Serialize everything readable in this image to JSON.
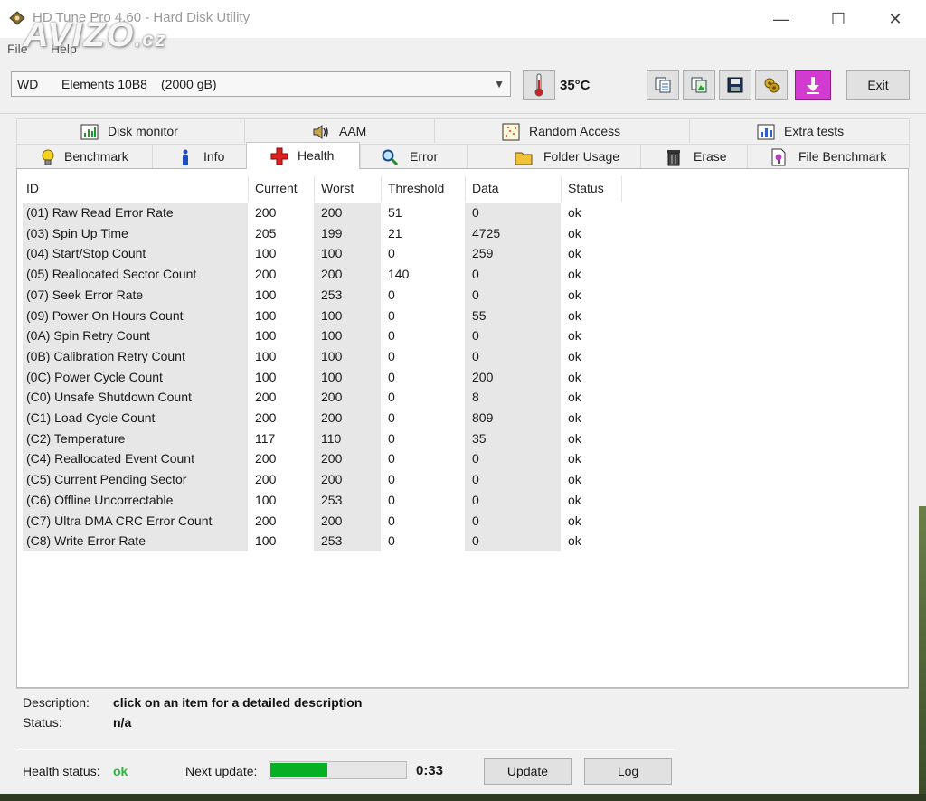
{
  "window": {
    "title": "HD Tune Pro 4.60 - Hard Disk Utility",
    "minimize": "—",
    "maximize": "☐",
    "close": "✕",
    "watermark": "AVIZO",
    "watermark_tld": ".cz"
  },
  "menu": {
    "file": "File",
    "help": "Help"
  },
  "toolbar": {
    "drive_vendor": "WD",
    "drive_model": "Elements 10B8",
    "drive_capacity": "(2000 gB)",
    "temperature": "35°C",
    "exit_label": "Exit",
    "icons": [
      "copy-info-icon",
      "copy-screenshot-icon",
      "save-icon",
      "options-icon",
      "download-icon"
    ]
  },
  "tabs": {
    "row1": [
      {
        "label": "Disk monitor",
        "icon": "disk-monitor-icon"
      },
      {
        "label": "AAM",
        "icon": "speaker-icon"
      },
      {
        "label": "Random Access",
        "icon": "random-access-icon"
      },
      {
        "label": "Extra tests",
        "icon": "extra-tests-icon"
      }
    ],
    "row2": [
      {
        "label": "Benchmark",
        "icon": "lightbulb-icon"
      },
      {
        "label": "Info",
        "icon": "info-icon"
      },
      {
        "label": "Health",
        "icon": "health-cross-icon",
        "active": true
      },
      {
        "label": "Error Scan",
        "icon": "magnifier-icon"
      },
      {
        "label": "Folder Usage",
        "icon": "folder-icon"
      },
      {
        "label": "Erase",
        "icon": "trash-icon"
      },
      {
        "label": "File Benchmark",
        "icon": "file-benchmark-icon"
      }
    ]
  },
  "smart_table": {
    "headers": [
      "ID",
      "Current",
      "Worst",
      "Threshold",
      "Data",
      "Status"
    ],
    "rows": [
      [
        "(01) Raw Read Error Rate",
        "200",
        "200",
        "51",
        "0",
        "ok"
      ],
      [
        "(03) Spin Up Time",
        "205",
        "199",
        "21",
        "4725",
        "ok"
      ],
      [
        "(04) Start/Stop Count",
        "100",
        "100",
        "0",
        "259",
        "ok"
      ],
      [
        "(05) Reallocated Sector Count",
        "200",
        "200",
        "140",
        "0",
        "ok"
      ],
      [
        "(07) Seek Error Rate",
        "100",
        "253",
        "0",
        "0",
        "ok"
      ],
      [
        "(09) Power On Hours Count",
        "100",
        "100",
        "0",
        "55",
        "ok"
      ],
      [
        "(0A) Spin Retry Count",
        "100",
        "100",
        "0",
        "0",
        "ok"
      ],
      [
        "(0B) Calibration Retry Count",
        "100",
        "100",
        "0",
        "0",
        "ok"
      ],
      [
        "(0C) Power Cycle Count",
        "100",
        "100",
        "0",
        "200",
        "ok"
      ],
      [
        "(C0) Unsafe Shutdown Count",
        "200",
        "200",
        "0",
        "8",
        "ok"
      ],
      [
        "(C1) Load Cycle Count",
        "200",
        "200",
        "0",
        "809",
        "ok"
      ],
      [
        "(C2) Temperature",
        "117",
        "110",
        "0",
        "35",
        "ok"
      ],
      [
        "(C4) Reallocated Event Count",
        "200",
        "200",
        "0",
        "0",
        "ok"
      ],
      [
        "(C5) Current Pending Sector",
        "200",
        "200",
        "0",
        "0",
        "ok"
      ],
      [
        "(C6) Offline Uncorrectable",
        "100",
        "253",
        "0",
        "0",
        "ok"
      ],
      [
        "(C7) Ultra DMA CRC Error Count",
        "200",
        "200",
        "0",
        "0",
        "ok"
      ],
      [
        "(C8) Write Error Rate",
        "100",
        "253",
        "0",
        "0",
        "ok"
      ]
    ]
  },
  "details": {
    "description_label": "Description:",
    "description_value": "click on an item for a detailed description",
    "status_label": "Status:",
    "status_value": "n/a"
  },
  "footer": {
    "health_label": "Health status:",
    "health_value": "ok",
    "health_color": "#2fb53c",
    "next_update_label": "Next update:",
    "next_update_progress": 0.42,
    "progress_color": "#06b025",
    "next_update_time": "0:33",
    "update_button": "Update",
    "log_button": "Log"
  }
}
